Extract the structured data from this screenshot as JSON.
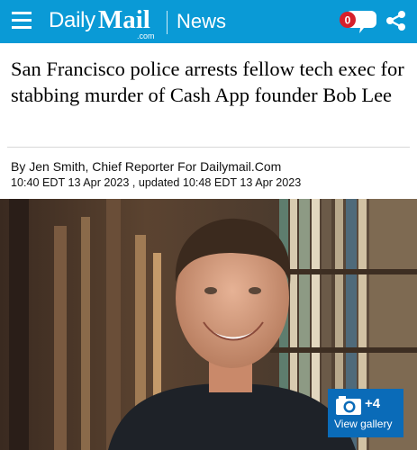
{
  "header": {
    "logo_daily": "Daily",
    "logo_mail": "Mail",
    "logo_com": ".com",
    "section": "News",
    "comment_count": "0",
    "brand_color": "#0a9ad6"
  },
  "article": {
    "headline": "San Francisco police arrests fellow tech exec for stabbing murder of Cash App founder Bob Lee",
    "byline": "By Jen Smith, Chief Reporter For Dailymail.Com",
    "dateline": "10:40 EDT 13 Apr 2023 , updated 10:48 EDT 13 Apr 2023"
  },
  "gallery": {
    "count": "+4",
    "label": "View gallery",
    "button_color": "#0a6bb8"
  },
  "icons": [
    "menu-icon",
    "comments-icon",
    "share-icon",
    "camera-icon"
  ]
}
